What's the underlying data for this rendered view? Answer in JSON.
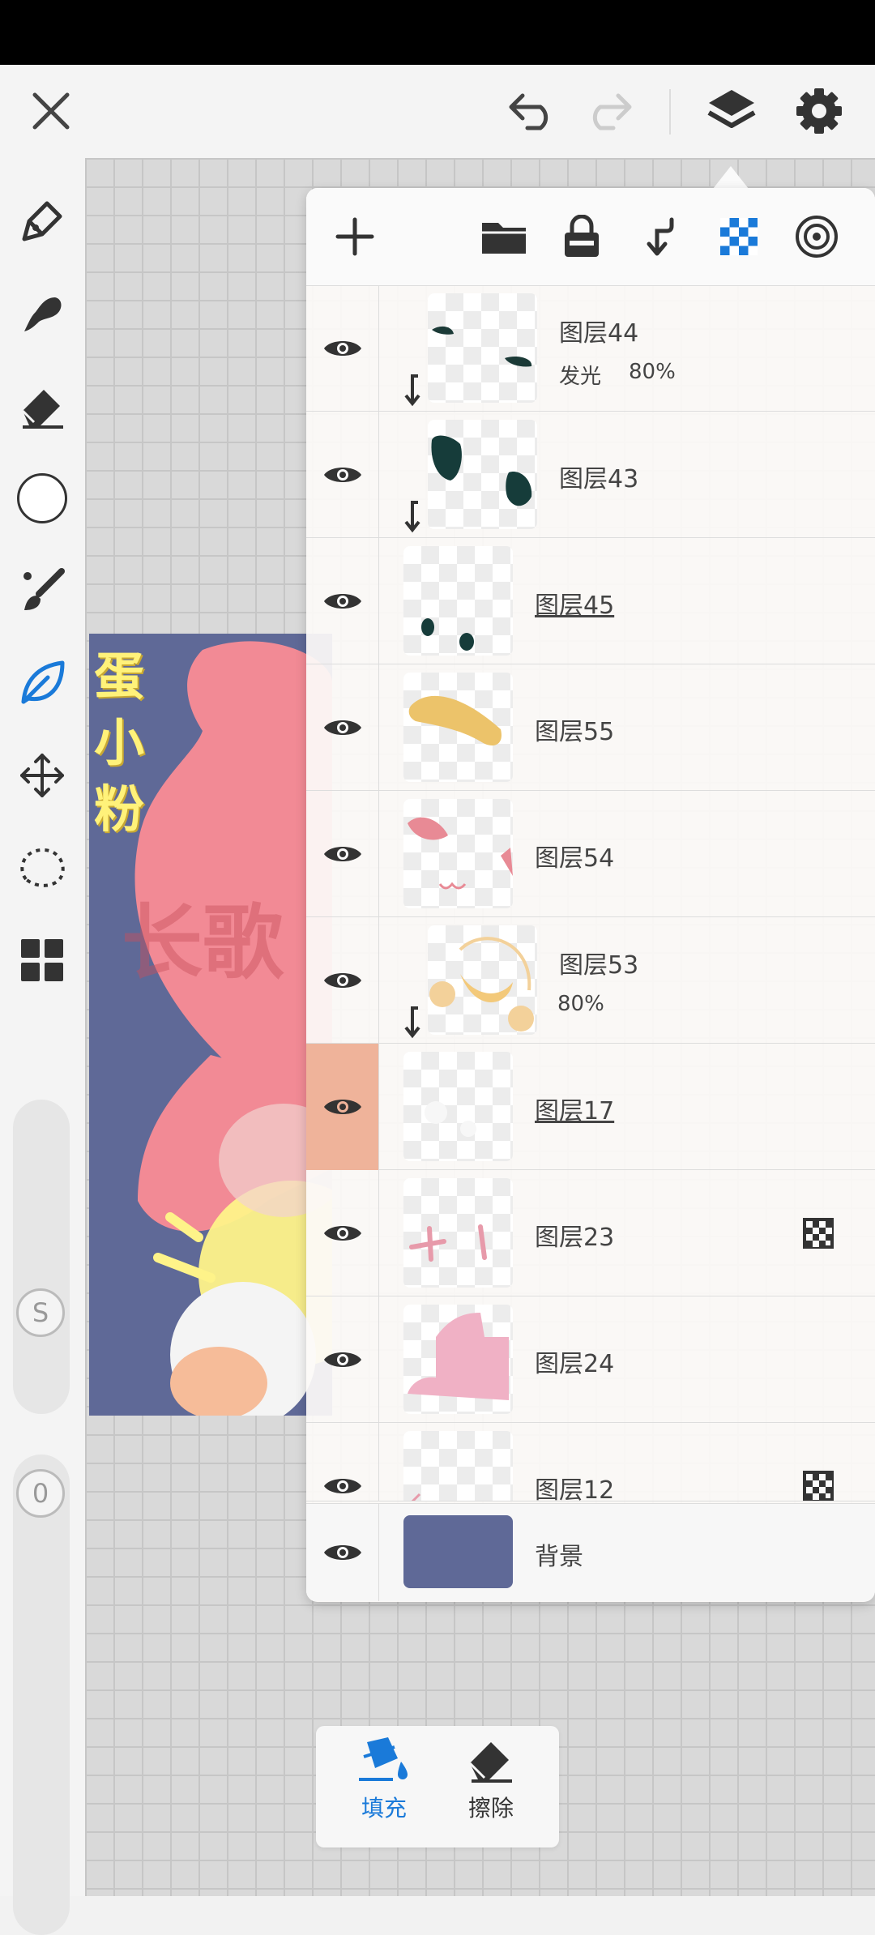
{
  "topbar": {
    "close_icon": "close-icon",
    "undo_icon": "undo-icon",
    "redo_icon": "redo-icon",
    "layers_icon": "layers-icon",
    "settings_icon": "gear-icon"
  },
  "toolbar": {
    "tools": [
      "pen-icon",
      "brush-icon",
      "eraser-icon",
      "color-swatch",
      "paint-brush-icon",
      "leaf-brush-icon",
      "move-icon",
      "lasso-icon",
      "grid-menu-icon"
    ],
    "active_tool": "leaf-brush-icon",
    "size_badge": "S",
    "opacity_badge": "0"
  },
  "artwork": {
    "title_chars": [
      "蛋",
      "小",
      "粉"
    ],
    "watermark": "长歌"
  },
  "panel_header": {
    "icons": [
      "add-icon",
      "folder-icon",
      "lock-icon",
      "clip-icon",
      "alpha-lock-icon",
      "mask-icon"
    ]
  },
  "layers": [
    {
      "name": "图层44",
      "blend": "发光",
      "opacity": "80%",
      "clipped": true
    },
    {
      "name": "图层43",
      "clipped": true
    },
    {
      "name": "图层45",
      "underline": true
    },
    {
      "name": "图层55"
    },
    {
      "name": "图层54"
    },
    {
      "name": "图层53",
      "opacity": "80%",
      "clipped": true
    },
    {
      "name": "图层17",
      "underline": true,
      "selected": true
    },
    {
      "name": "图层23",
      "alpha_locked": true
    },
    {
      "name": "图层24"
    },
    {
      "name": "图层12",
      "alpha_locked": true
    }
  ],
  "background_layer": {
    "name": "背景"
  },
  "fill_tool": {
    "fill_label": "填充",
    "erase_label": "擦除",
    "active": "fill",
    "accent": "#1a7ad9"
  }
}
